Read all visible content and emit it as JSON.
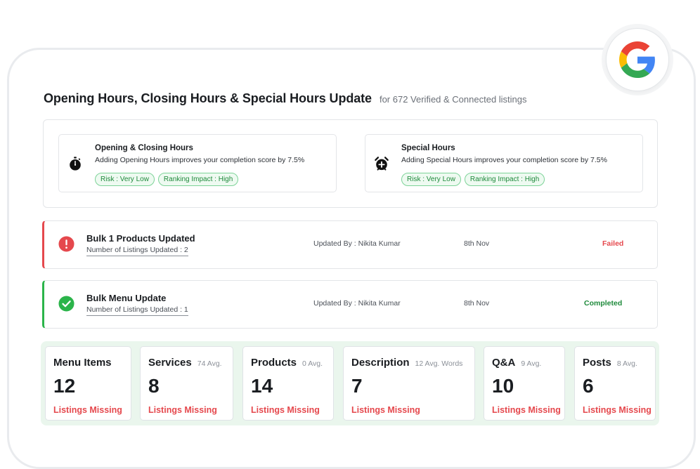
{
  "header": {
    "title": "Opening Hours, Closing Hours & Special Hours Update",
    "subtitle": "for 672 Verified & Connected listings"
  },
  "google_badge": {
    "icon": "google-logo-icon"
  },
  "hours": [
    {
      "name": "Opening & Closing Hours",
      "description": "Adding Opening Hours improves your completion score by 7.5%",
      "icon": "stopwatch-icon",
      "risk": "Risk : Very Low",
      "impact": "Ranking Impact : High"
    },
    {
      "name": "Special Hours",
      "description": "Adding Special Hours improves your completion score by 7.5%",
      "icon": "alarm-clock-plus-icon",
      "risk": "Risk : Very Low",
      "impact": "Ranking Impact : High"
    }
  ],
  "updates": [
    {
      "title": "Bulk 1 Products Updated",
      "count": "Number of Listings Updated : 2",
      "updated_by": "Updated By : Nikita Kumar",
      "date": "8th Nov",
      "status": "Failed",
      "icon": "error-icon",
      "color": "#e5484d"
    },
    {
      "title": "Bulk Menu Update",
      "count": "Number of Listings Updated : 1",
      "updated_by": "Updated By : Nikita Kumar",
      "date": "8th Nov",
      "status": "Completed",
      "icon": "check-circle-icon",
      "color": "#2bb44a"
    }
  ],
  "stats": [
    {
      "label": "Menu Items",
      "avg": "",
      "value": "12",
      "missing": "Listings Missing"
    },
    {
      "label": "Services",
      "avg": "74 Avg.",
      "value": "8",
      "missing": "Listings Missing"
    },
    {
      "label": "Products",
      "avg": "0 Avg.",
      "value": "14",
      "missing": "Listings Missing"
    },
    {
      "label": "Description",
      "avg": "12 Avg. Words",
      "value": "7",
      "missing": "Listings Missing"
    },
    {
      "label": "Q&A",
      "avg": "9 Avg.",
      "value": "10",
      "missing": "Listings Missing"
    },
    {
      "label": "Posts",
      "avg": "8 Avg.",
      "value": "6",
      "missing": "Listings Missing"
    }
  ],
  "colors": {
    "success": "#1e8a3b",
    "danger": "#e5484d",
    "stats_background": "#eaf6ed"
  }
}
